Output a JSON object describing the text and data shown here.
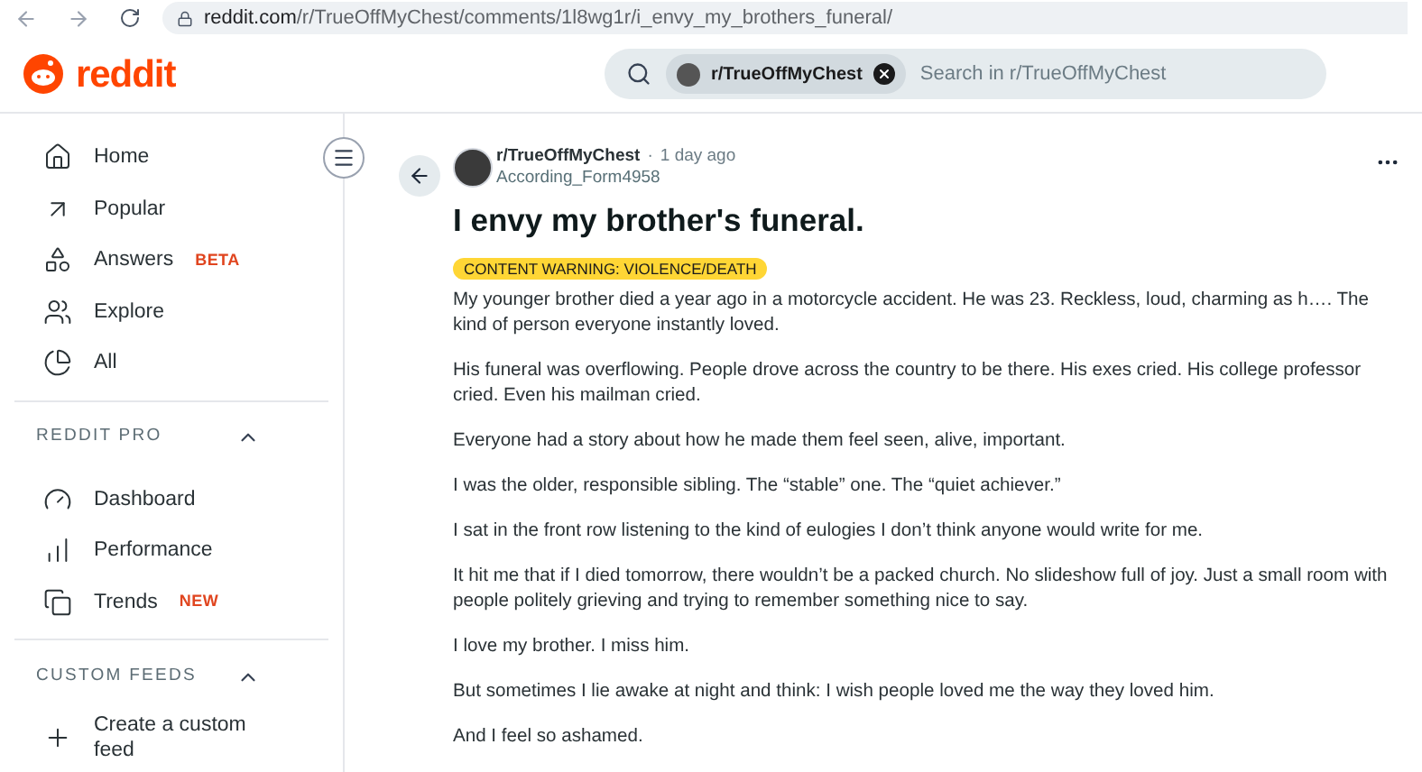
{
  "browser": {
    "url_host": "reddit.com",
    "url_path": "/r/TrueOffMyChest/comments/1l8wg1r/i_envy_my_brothers_funeral/"
  },
  "header": {
    "logo": "reddit",
    "search": {
      "community": "r/TrueOffMyChest",
      "placeholder": "Search in r/TrueOffMyChest"
    }
  },
  "sidebar": {
    "items": [
      {
        "label": "Home"
      },
      {
        "label": "Popular"
      },
      {
        "label": "Answers",
        "badge": "BETA"
      },
      {
        "label": "Explore"
      },
      {
        "label": "All"
      }
    ],
    "sections": [
      {
        "title": "REDDIT PRO",
        "expanded": true,
        "items": [
          {
            "label": "Dashboard"
          },
          {
            "label": "Performance"
          },
          {
            "label": "Trends",
            "badge": "NEW"
          }
        ]
      },
      {
        "title": "CUSTOM FEEDS",
        "expanded": true,
        "items": [
          {
            "label": "Create a custom feed"
          }
        ]
      }
    ]
  },
  "post": {
    "community": "r/TrueOffMyChest",
    "separator": "·",
    "age": "1 day ago",
    "author": "According_Form4958",
    "title": "I envy my brother's funeral.",
    "flair": "CONTENT WARNING: VIOLENCE/DEATH",
    "paragraphs": [
      "My younger brother died a year ago in a motorcycle accident. He was 23. Reckless, loud, charming as h…. The kind of person everyone instantly loved.",
      "His funeral was overflowing. People drove across the country to be there. His exes cried. His college professor cried. Even his mailman cried.",
      "Everyone had a story about how he made them feel seen, alive, important.",
      "I was the older, responsible sibling. The “stable” one. The “quiet achiever.”",
      "I sat in the front row listening to the kind of eulogies I don’t think anyone would write for me.",
      "It hit me that if I died tomorrow, there wouldn’t be a packed church. No slideshow full of joy. Just a small room with people politely grieving and trying to remember something nice to say.",
      "I love my brother. I miss him.",
      "But sometimes I lie awake at night and think: I wish people loved me the way they loved him.",
      "And I feel so ashamed."
    ]
  }
}
